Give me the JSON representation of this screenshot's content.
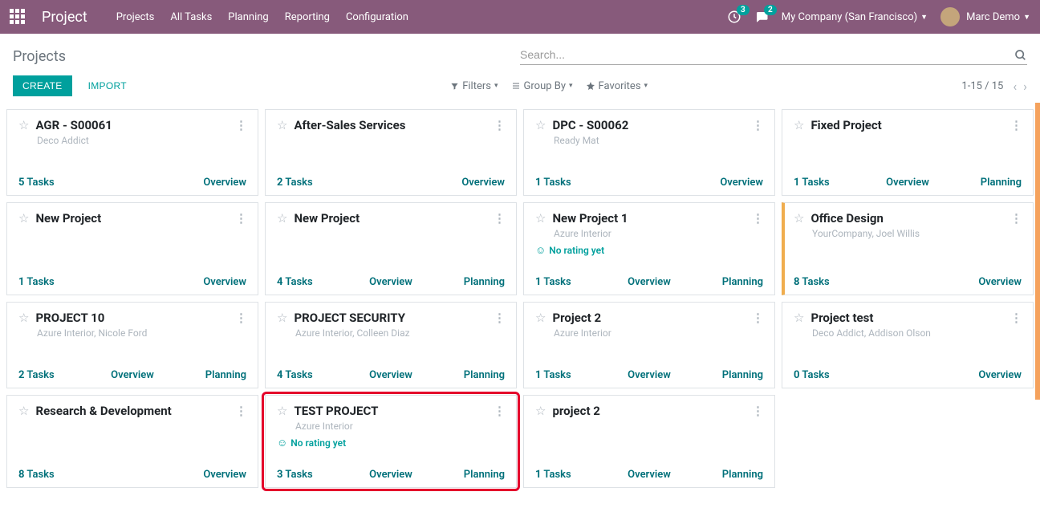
{
  "topnav": {
    "brand": "Project",
    "links": [
      "Projects",
      "All Tasks",
      "Planning",
      "Reporting",
      "Configuration"
    ],
    "badge1": "3",
    "badge2": "2",
    "company": "My Company (San Francisco)",
    "user": "Marc Demo"
  },
  "controls": {
    "breadcrumb": "Projects",
    "search_placeholder": "Search...",
    "create": "CREATE",
    "import": "IMPORT",
    "filters": "Filters",
    "groupby": "Group By",
    "favorites": "Favorites",
    "pager": "1-15 / 15"
  },
  "labels": {
    "tasks": "Tasks",
    "overview": "Overview",
    "planning": "Planning",
    "no_rating": "No rating yet"
  },
  "cards": [
    {
      "title": "AGR - S00061",
      "sub": "Deco Addict",
      "tasks": "5",
      "links": [
        "overview"
      ],
      "rating": false,
      "gold": false
    },
    {
      "title": "After-Sales Services",
      "sub": "",
      "tasks": "2",
      "links": [
        "overview"
      ],
      "rating": false,
      "gold": false
    },
    {
      "title": "DPC - S00062",
      "sub": "Ready Mat",
      "tasks": "1",
      "links": [
        "overview"
      ],
      "rating": false,
      "gold": false
    },
    {
      "title": "Fixed Project",
      "sub": "",
      "tasks": "1",
      "links": [
        "overview",
        "planning"
      ],
      "rating": false,
      "gold": false
    },
    {
      "title": "New Project",
      "sub": "",
      "tasks": "1",
      "links": [
        "overview"
      ],
      "rating": false,
      "gold": false
    },
    {
      "title": "New Project",
      "sub": "",
      "tasks": "4",
      "links": [
        "overview",
        "planning"
      ],
      "rating": false,
      "gold": false
    },
    {
      "title": "New Project 1",
      "sub": "Azure Interior",
      "tasks": "1",
      "links": [
        "overview",
        "planning"
      ],
      "rating": true,
      "gold": false
    },
    {
      "title": "Office Design",
      "sub": "YourCompany, Joel Willis",
      "tasks": "8",
      "links": [
        "overview"
      ],
      "rating": false,
      "gold": true
    },
    {
      "title": "PROJECT 10",
      "sub": "Azure Interior, Nicole Ford",
      "tasks": "2",
      "links": [
        "overview",
        "planning"
      ],
      "rating": false,
      "gold": false
    },
    {
      "title": "PROJECT SECURITY",
      "sub": "Azure Interior, Colleen Diaz",
      "tasks": "4",
      "links": [
        "overview",
        "planning"
      ],
      "rating": false,
      "gold": false
    },
    {
      "title": "Project 2",
      "sub": "Azure Interior",
      "tasks": "1",
      "links": [
        "overview",
        "planning"
      ],
      "rating": false,
      "gold": false
    },
    {
      "title": "Project test",
      "sub": "Deco Addict, Addison Olson",
      "tasks": "0",
      "links": [
        "overview"
      ],
      "rating": false,
      "gold": false
    },
    {
      "title": "Research & Development",
      "sub": "",
      "tasks": "8",
      "links": [
        "overview"
      ],
      "rating": false,
      "gold": false
    },
    {
      "title": "TEST PROJECT",
      "sub": "Azure Interior",
      "tasks": "3",
      "links": [
        "overview",
        "planning"
      ],
      "rating": true,
      "gold": false
    },
    {
      "title": "project 2",
      "sub": "",
      "tasks": "1",
      "links": [
        "overview",
        "planning"
      ],
      "rating": false,
      "gold": false
    }
  ],
  "highlight_index": 13
}
